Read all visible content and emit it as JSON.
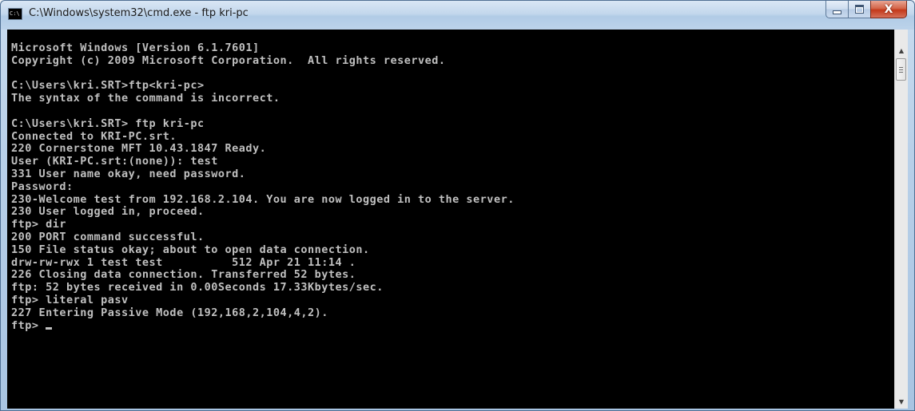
{
  "window": {
    "title": "C:\\Windows\\system32\\cmd.exe - ftp  kri-pc",
    "icon_label": "C:\\",
    "buttons": {
      "minimize": "minimize-icon",
      "maximize": "maximize-icon",
      "close": "close-icon"
    }
  },
  "console": {
    "colors": {
      "background": "#000000",
      "text": "#c0c0c0"
    },
    "lines": [
      "Microsoft Windows [Version 6.1.7601]",
      "Copyright (c) 2009 Microsoft Corporation.  All rights reserved.",
      "",
      "C:\\Users\\kri.SRT>ftp<kri-pc>",
      "The syntax of the command is incorrect.",
      "",
      "C:\\Users\\kri.SRT> ftp kri-pc",
      "Connected to KRI-PC.srt.",
      "220 Cornerstone MFT 10.43.1847 Ready.",
      "User (KRI-PC.srt:(none)): test",
      "331 User name okay, need password.",
      "Password:",
      "230-Welcome test from 192.168.2.104. You are now logged in to the server.",
      "230 User logged in, proceed.",
      "ftp> dir",
      "200 PORT command successful.",
      "150 File status okay; about to open data connection.",
      "drw-rw-rwx 1 test test          512 Apr 21 11:14 .",
      "226 Closing data connection. Transferred 52 bytes.",
      "ftp: 52 bytes received in 0.00Seconds 17.33Kbytes/sec.",
      "ftp> literal pasv",
      "227 Entering Passive Mode (192,168,2,104,4,2).",
      "ftp> "
    ]
  },
  "scrollbar": {
    "up_arrow": "▲",
    "down_arrow": "▼"
  }
}
